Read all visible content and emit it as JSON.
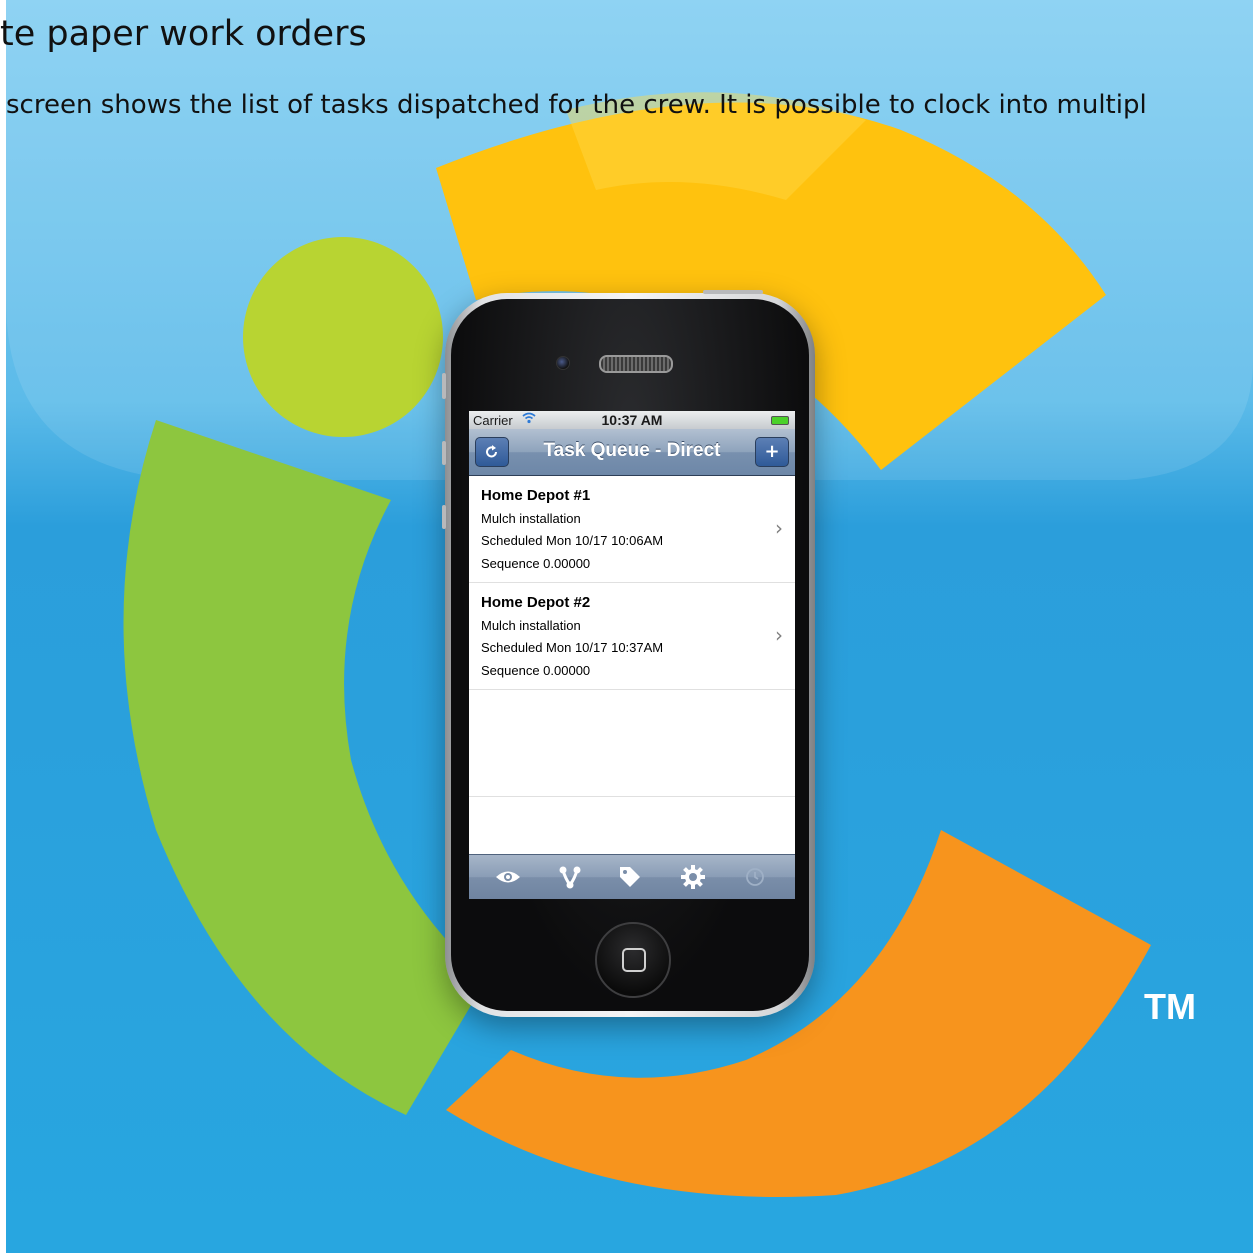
{
  "page": {
    "heading": "te paper work orders",
    "description": "screen shows the list of tasks dispatched for the crew.  It is possible to clock into multipl",
    "trademark": "TM"
  },
  "brand_colors": {
    "sky_blue": "#29a7e0",
    "green": "#8dc63f",
    "yellow": "#ffc20e",
    "orange": "#f7941d",
    "dot_green": "#b8d432"
  },
  "phone": {
    "status_bar": {
      "carrier": "Carrier",
      "time": "10:37 AM"
    },
    "nav_bar": {
      "title": "Task Queue - Direct",
      "left_icon": "refresh-icon",
      "right_icon": "plus-icon"
    },
    "tasks": [
      {
        "title": "Home Depot #1",
        "subtitle": "Mulch installation",
        "scheduled": "Scheduled Mon 10/17 10:06AM",
        "sequence": "Sequence 0.00000"
      },
      {
        "title": "Home Depot #2",
        "subtitle": "Mulch installation",
        "scheduled": "Scheduled Mon 10/17 10:37AM",
        "sequence": "Sequence 0.00000"
      }
    ],
    "tab_bar": {
      "icons": [
        "eye-icon",
        "branch-icon",
        "tag-icon",
        "gear-icon",
        "clock-icon"
      ],
      "disabled": [
        "clock-icon"
      ]
    }
  }
}
